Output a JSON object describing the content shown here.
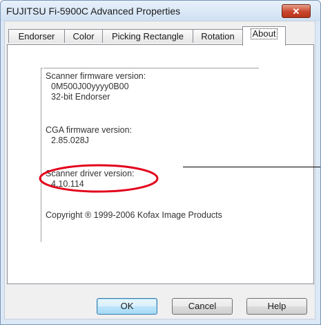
{
  "window": {
    "title": "FUJITSU Fi-5900C Advanced Properties",
    "close_glyph": "✕"
  },
  "tabs": [
    {
      "label": "Endorser",
      "active": false
    },
    {
      "label": "Color",
      "active": false
    },
    {
      "label": "Picking Rectangle",
      "active": false
    },
    {
      "label": "Rotation",
      "active": false
    },
    {
      "label": "About",
      "active": true
    }
  ],
  "about": {
    "scanner_firmware_label": "Scanner firmware version:",
    "scanner_firmware_value": "0M500J00yyyy0B00",
    "scanner_firmware_extra": "32-bit Endorser",
    "cga_firmware_label": "CGA firmware version:",
    "cga_firmware_value": "2.85.028J",
    "driver_label": "Scanner driver version:",
    "driver_value": "4.10.114",
    "copyright": "Copyright ® 1999-2006 Kofax Image Products"
  },
  "buttons": {
    "ok": "OK",
    "cancel": "Cancel",
    "help": "Help"
  },
  "annotation": {
    "highlight_color": "#e3001b"
  }
}
